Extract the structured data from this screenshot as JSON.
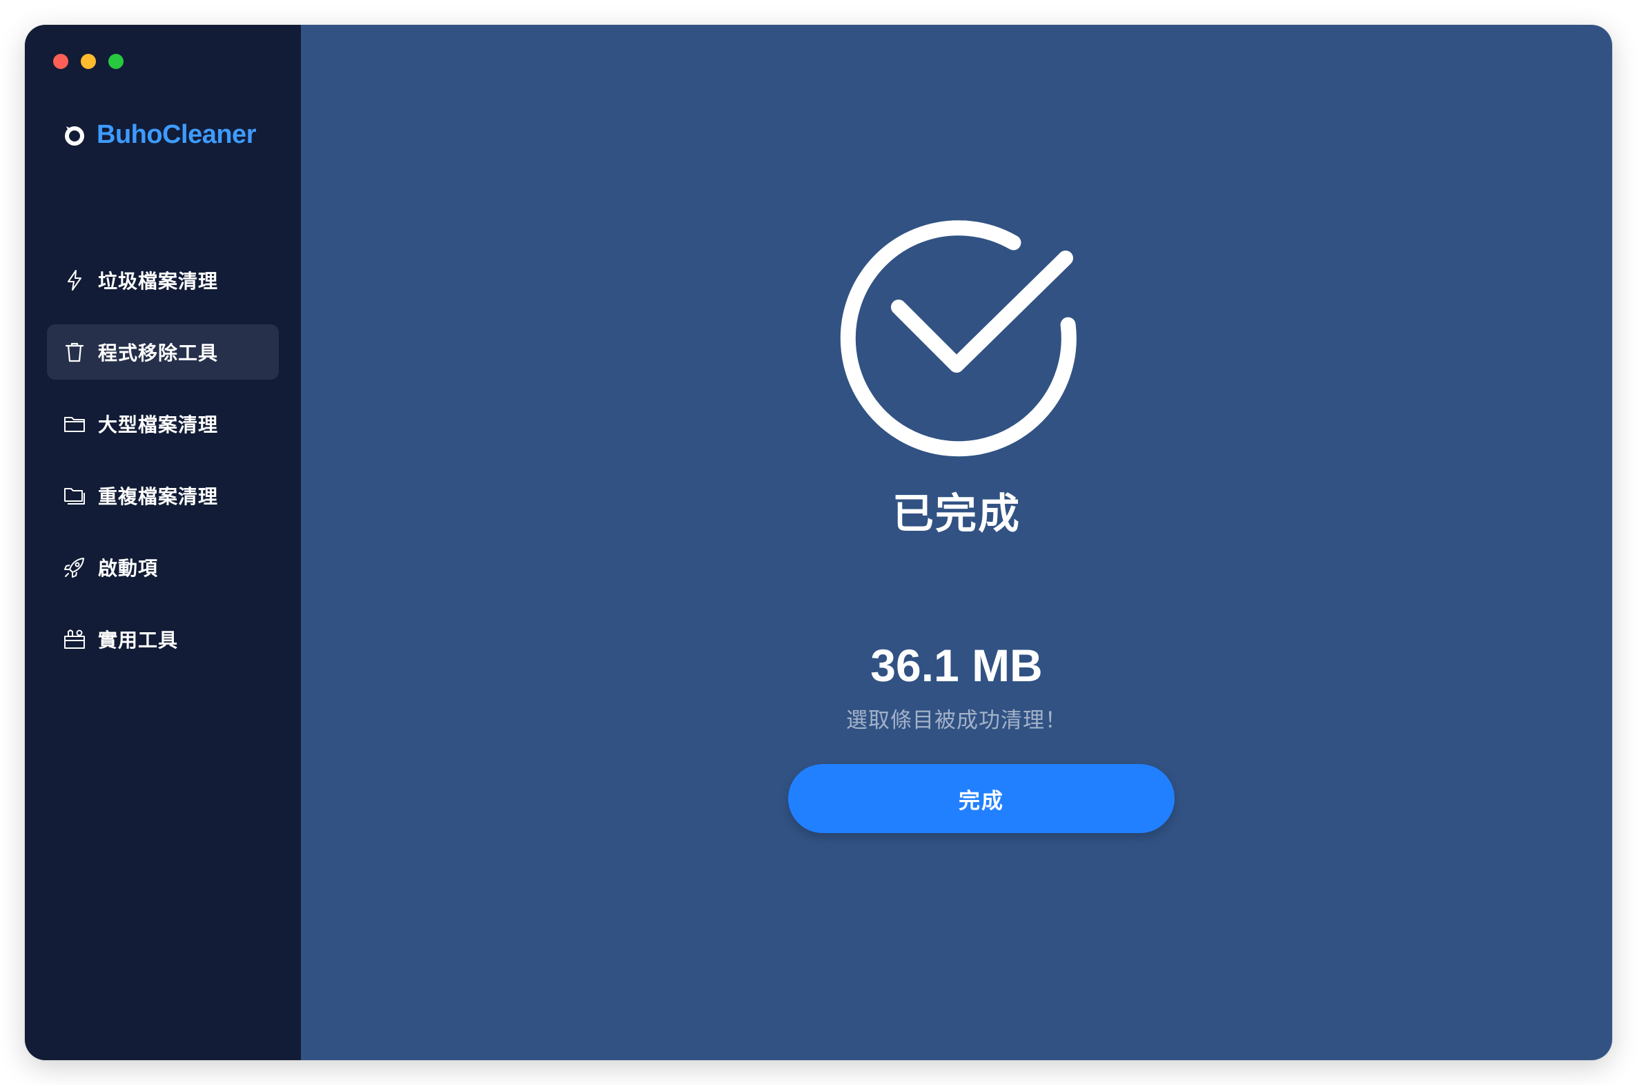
{
  "app": {
    "name": "BuhoCleaner"
  },
  "colors": {
    "sidebar_bg": "#121c36",
    "main_bg": "#315283",
    "accent": "#2180ff",
    "brand": "#3e9bff",
    "traffic_red": "#fe5f57",
    "traffic_yellow": "#febc2e",
    "traffic_green": "#28c840"
  },
  "sidebar": {
    "items": [
      {
        "label": "垃圾檔案清理",
        "icon": "lightning-icon",
        "active": false
      },
      {
        "label": "程式移除工具",
        "icon": "trash-icon",
        "active": true
      },
      {
        "label": "大型檔案清理",
        "icon": "folder-icon",
        "active": false
      },
      {
        "label": "重複檔案清理",
        "icon": "duplicate-folder-icon",
        "active": false
      },
      {
        "label": "啟動項",
        "icon": "rocket-icon",
        "active": false
      },
      {
        "label": "實用工具",
        "icon": "toolbox-icon",
        "active": false
      }
    ]
  },
  "main": {
    "status_icon": "checkmark-circle-icon",
    "status_title": "已完成",
    "size_value": "36.1 MB",
    "result_message": "選取條目被成功清理！",
    "done_button_label": "完成"
  }
}
